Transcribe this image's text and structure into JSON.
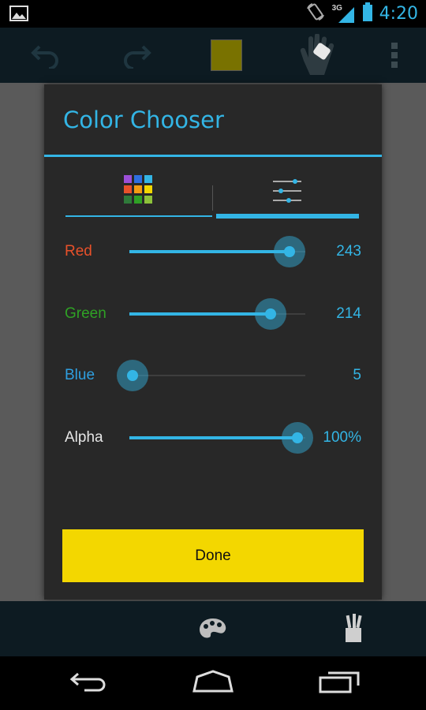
{
  "status_bar": {
    "time": "4:20",
    "network": "3G",
    "icons": [
      "gallery-icon",
      "rotate-icon",
      "signal-icon",
      "battery-icon"
    ]
  },
  "action_bar": {
    "icons": [
      "undo-icon",
      "redo-icon",
      "color-swatch",
      "hand-tool-icon",
      "overflow-menu-icon"
    ],
    "current_color": "#797200"
  },
  "dialog": {
    "title": "Color Chooser",
    "tabs": [
      {
        "icon": "color-grid-icon",
        "selected": false
      },
      {
        "icon": "sliders-icon",
        "selected": true
      }
    ],
    "sliders": [
      {
        "label": "Red",
        "label_color": "#e8512a",
        "value": "243",
        "level": 243,
        "max": 255
      },
      {
        "label": "Green",
        "label_color": "#2fa125",
        "value": "214",
        "level": 214,
        "max": 255
      },
      {
        "label": "Blue",
        "label_color": "#2f9fe0",
        "value": "5",
        "level": 5,
        "max": 255
      },
      {
        "label": "Alpha",
        "label_color": "#e6e6e6",
        "value": "100%",
        "level": 100,
        "max": 100
      }
    ],
    "done_label": "Done",
    "done_color": "#f3d700"
  },
  "bottom_bar": {
    "icons": [
      "palette-icon",
      "brushes-icon"
    ]
  },
  "nav_bar": {
    "icons": [
      "back-icon",
      "home-icon",
      "recent-apps-icon"
    ]
  },
  "accent_color": "#33b5e5"
}
